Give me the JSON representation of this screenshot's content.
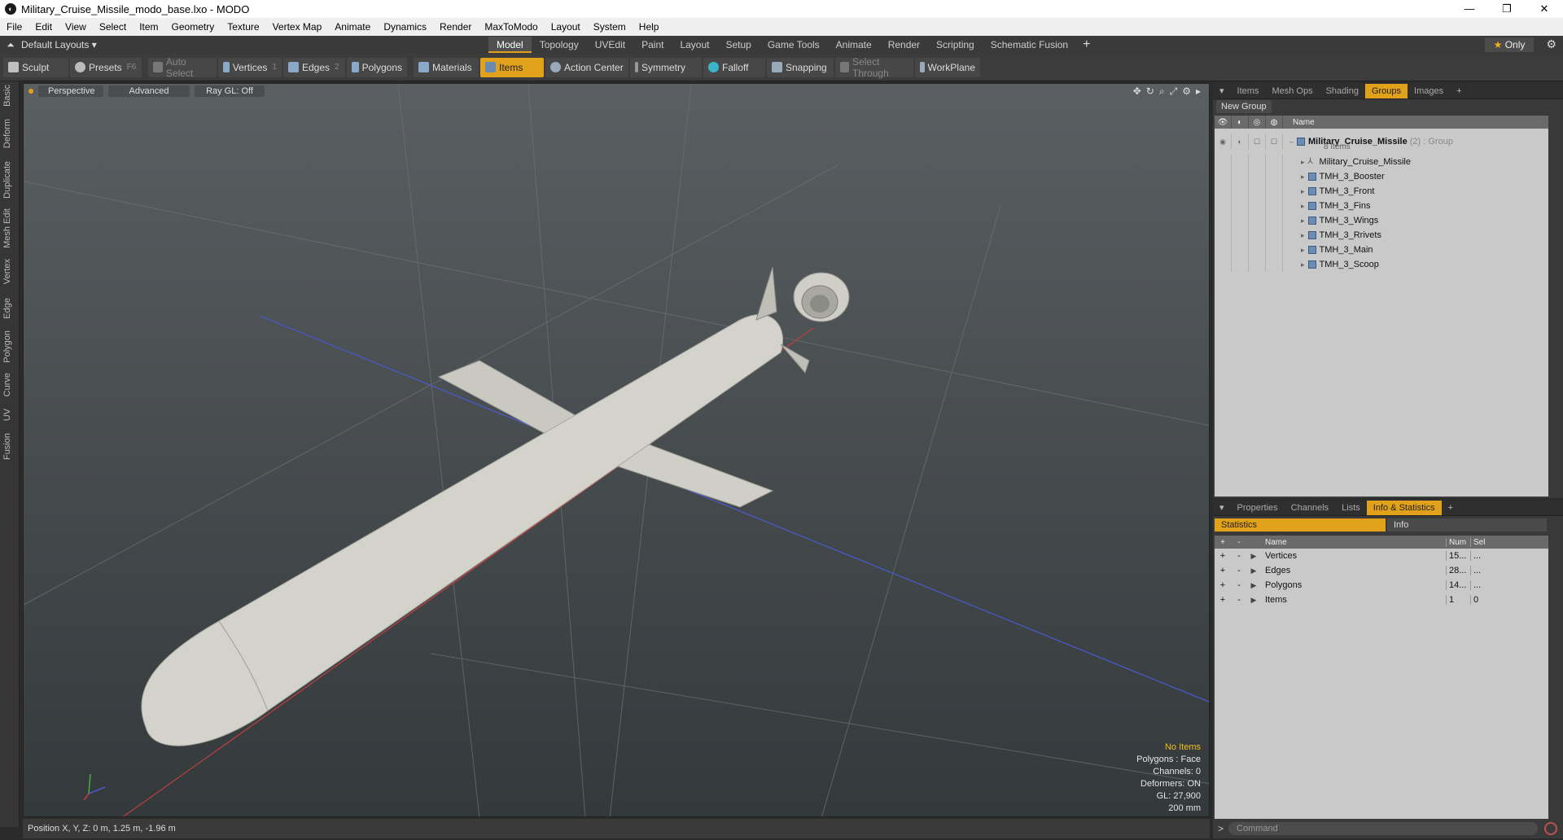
{
  "window": {
    "title": "Military_Cruise_Missile_modo_base.lxo - MODO",
    "min": "—",
    "max": "❐",
    "close": "✕"
  },
  "menu": [
    "File",
    "Edit",
    "View",
    "Select",
    "Item",
    "Geometry",
    "Texture",
    "Vertex Map",
    "Animate",
    "Dynamics",
    "Render",
    "MaxToModo",
    "Layout",
    "System",
    "Help"
  ],
  "layouts": {
    "current": "Default Layouts ▾",
    "tabs": [
      "Model",
      "Topology",
      "UVEdit",
      "Paint",
      "Layout",
      "Setup",
      "Game Tools",
      "Animate",
      "Render",
      "Scripting",
      "Schematic Fusion"
    ],
    "active": "Model",
    "only": "Only"
  },
  "toolbar": {
    "sculpt": "Sculpt",
    "presets": "Presets",
    "presets_key": "F6",
    "auto_select": "Auto Select",
    "vertices": "Vertices",
    "vertices_key": "1",
    "edges": "Edges",
    "edges_key": "2",
    "polygons": "Polygons",
    "materials": "Materials",
    "items": "Items",
    "action_center": "Action Center",
    "symmetry": "Symmetry",
    "falloff": "Falloff",
    "snapping": "Snapping",
    "select_through": "Select Through",
    "workplane": "WorkPlane"
  },
  "left_tabs": [
    "Basic",
    "Deform",
    "Duplicate",
    "Mesh Edit",
    "Vertex",
    "Edge",
    "Polygon",
    "Curve",
    "UV",
    "Fusion"
  ],
  "viewport": {
    "perspective": "Perspective",
    "advanced": "Advanced",
    "raygl": "Ray GL: Off",
    "info": {
      "no_items": "No Items",
      "polygons": "Polygons : Face",
      "channels": "Channels: 0",
      "deformers": "Deformers: ON",
      "gl": "GL: 27,900",
      "size": "200 mm"
    }
  },
  "status": {
    "position": "Position X, Y, Z:  0 m, 1.25 m, -1.96 m"
  },
  "groups_panel": {
    "tabs": [
      "Items",
      "Mesh Ops",
      "Shading",
      "Groups",
      "Images"
    ],
    "active": "Groups",
    "new_group": "New Group",
    "col_name": "Name",
    "group": {
      "name": "Military_Cruise_Missile",
      "count": "(2)",
      "type": ": Group",
      "sub": "8 Items"
    },
    "items": [
      "Military_Cruise_Missile",
      "TMH_3_Booster",
      "TMH_3_Front",
      "TMH_3_Fins",
      "TMH_3_Wings",
      "TMH_3_Rrivets",
      "TMH_3_Main",
      "TMH_3_Scoop"
    ]
  },
  "stats_panel": {
    "tabs": [
      "Properties",
      "Channels",
      "Lists",
      "Info & Statistics"
    ],
    "active": "Info & Statistics",
    "statistics": "Statistics",
    "info": "Info",
    "cols": {
      "name": "Name",
      "num": "Num",
      "sel": "Sel"
    },
    "rows": [
      {
        "name": "Vertices",
        "num": "15...",
        "sel": "..."
      },
      {
        "name": "Edges",
        "num": "28...",
        "sel": "..."
      },
      {
        "name": "Polygons",
        "num": "14...",
        "sel": "..."
      },
      {
        "name": "Items",
        "num": "1",
        "sel": "0"
      }
    ]
  },
  "command": {
    "placeholder": "Command"
  }
}
